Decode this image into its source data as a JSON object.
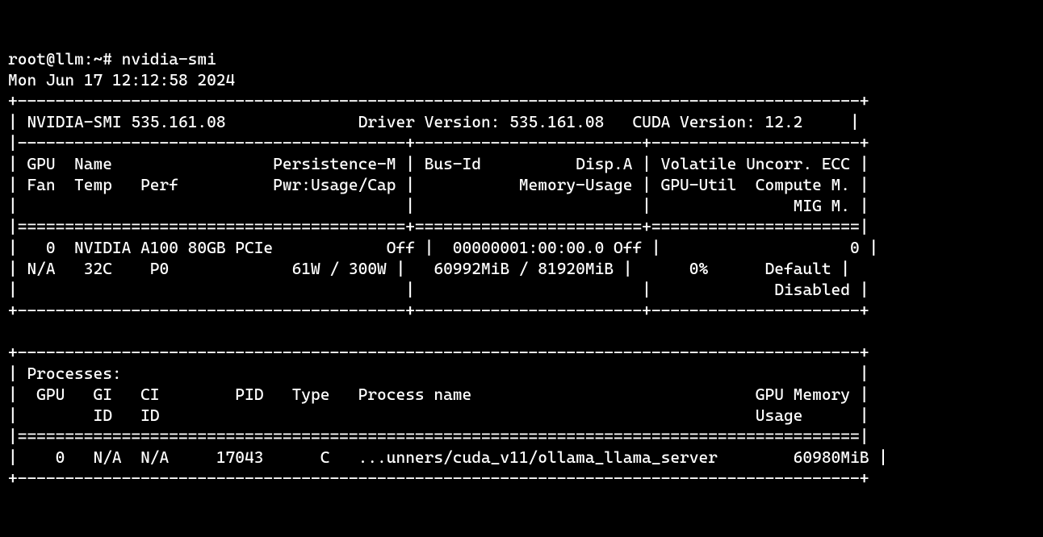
{
  "prompt": "root@llm:~# ",
  "command": "nvidia-smi",
  "timestamp": "Mon Jun 17 12:12:58 2024",
  "smi_version": "NVIDIA-SMI 535.161.08",
  "driver_version_label": "Driver Version:",
  "driver_version": "535.161.08",
  "cuda_version_label": "CUDA Version:",
  "cuda_version": "12.2",
  "headers": {
    "gpu": "GPU",
    "name": "Name",
    "persistence": "Persistence-M",
    "fan": "Fan",
    "temp": "Temp",
    "perf": "Perf",
    "pwr": "Pwr:Usage/Cap",
    "busid": "Bus-Id",
    "dispa": "Disp.A",
    "memusage": "Memory-Usage",
    "volatile": "Volatile",
    "uncorr": "Uncorr. ECC",
    "gpuutil": "GPU-Util",
    "compute": "Compute M.",
    "mig": "MIG M."
  },
  "gpu": {
    "index": "0",
    "name": "NVIDIA A100 80GB PCIe",
    "persistence": "Off",
    "fan": "N/A",
    "temp": "32C",
    "perf": "P0",
    "pwr": "61W / 300W",
    "busid": "00000001:00:00.0",
    "dispa": "Off",
    "memusage": "60992MiB / 81920MiB",
    "gpuutil": "0%",
    "ecc": "0",
    "compute": "Default",
    "mig": "Disabled"
  },
  "proc_section": "Processes:",
  "proc_headers": {
    "gpu": "GPU",
    "gi": "GI",
    "giid": "ID",
    "ci": "CI",
    "ciid": "ID",
    "pid": "PID",
    "type": "Type",
    "name": "Process name",
    "mem": "GPU Memory",
    "usage": "Usage"
  },
  "process": {
    "gpu": "0",
    "gi": "N/A",
    "ci": "N/A",
    "pid": "17043",
    "type": "C",
    "name": "...unners/cuda_v11/ollama_llama_server",
    "mem": "60980MiB"
  }
}
